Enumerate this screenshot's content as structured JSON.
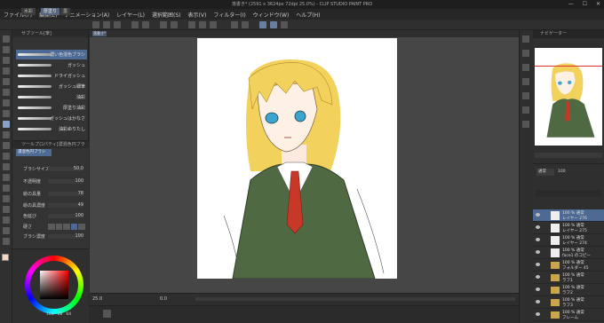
{
  "app": {
    "title": "落書き* (2591 x 3624px 72dpi 25.0%) - CLIP STUDIO PAINT PRO",
    "window_controls": [
      "—",
      "☐",
      "✕"
    ]
  },
  "menu": [
    "ファイル(F)",
    "編集(E)",
    "アニメーション(A)",
    "レイヤー(L)",
    "選択範囲(S)",
    "表示(V)",
    "フィルター(I)",
    "ウィンドウ(W)",
    "ヘルプ(H)"
  ],
  "subtool": {
    "header": "サブツール[筆]",
    "tabs": [
      "水彩",
      "厚塗り",
      "墨"
    ],
    "brushes": [
      "濃い色混色ブラシ",
      "ガッシュ",
      "ドライガッシュ",
      "ガッシュ細筆",
      "油彩",
      "厚塗り油彩",
      "ガッシュはかなさ",
      "油彩ぬりたし"
    ]
  },
  "toolprops": {
    "header": "ツールプロパティ[濃混色円ブラシ]",
    "brush_name": "濃混色円ブラシ",
    "rows": [
      {
        "name": "ブラシサイズ",
        "value": "50.0"
      },
      {
        "name": "不透明度",
        "value": "100"
      },
      {
        "name": "絵の具量",
        "value": "78"
      },
      {
        "name": "絵の具濃度",
        "value": "49"
      },
      {
        "name": "色延び",
        "value": "100"
      },
      {
        "name": "硬さ",
        "value": ""
      },
      {
        "name": "ブラシ濃度",
        "value": "100"
      }
    ]
  },
  "canvas": {
    "tab": "落書き*",
    "zoom": "25.0",
    "angle": "0.0"
  },
  "color": {
    "values": [
      "104",
      "68",
      "64"
    ]
  },
  "navigator": {
    "header": "ナビゲーター"
  },
  "layers": {
    "header": "レイヤー",
    "mode": "通常",
    "opacity": "100",
    "rows": [
      {
        "t1": "100 % 通常",
        "t2": "レイヤー 276",
        "type": "raster",
        "selected": true
      },
      {
        "t1": "100 % 通常",
        "t2": "レイヤー 275",
        "type": "raster",
        "selected": false
      },
      {
        "t1": "100 % 通常",
        "t2": "レイヤー 274",
        "type": "raster",
        "selected": false
      },
      {
        "t1": "100 % 通常",
        "t2": "face1 のコピー",
        "type": "raster",
        "selected": false
      },
      {
        "t1": "100 % 通常",
        "t2": "フォルダー 45",
        "type": "folder",
        "selected": false
      },
      {
        "t1": "100 % 通常",
        "t2": "ラフ1",
        "type": "folder",
        "selected": false
      },
      {
        "t1": "100 % 通常",
        "t2": "ラフ2",
        "type": "folder",
        "selected": false
      },
      {
        "t1": "100 % 通常",
        "t2": "ラフ3",
        "type": "folder",
        "selected": false
      },
      {
        "t1": "100 % 通常",
        "t2": "フレーム",
        "type": "folder",
        "selected": false
      }
    ]
  },
  "colors": {
    "selection": "#4c6a94",
    "hair": "#f2d25c",
    "jacket": "#4f6a43",
    "tie": "#c83828",
    "eyes": "#3aa6d0"
  }
}
